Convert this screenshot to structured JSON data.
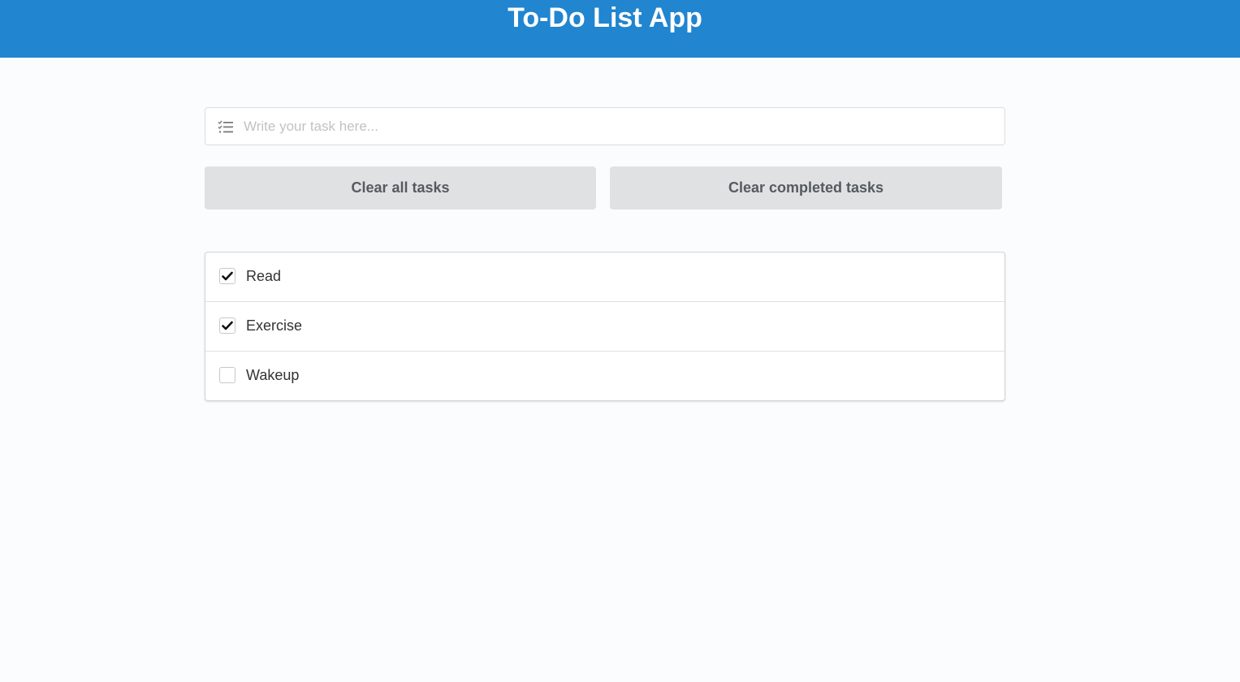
{
  "header": {
    "title": "To-Do List App",
    "background_color": "#2185d0"
  },
  "task_input": {
    "icon": "tasks-icon",
    "placeholder": "Write your task here...",
    "value": ""
  },
  "buttons": {
    "clear_all_label": "Clear all tasks",
    "clear_completed_label": "Clear completed tasks"
  },
  "tasks": [
    {
      "label": "Read",
      "completed": true
    },
    {
      "label": "Exercise",
      "completed": true
    },
    {
      "label": "Wakeup",
      "completed": false
    }
  ]
}
